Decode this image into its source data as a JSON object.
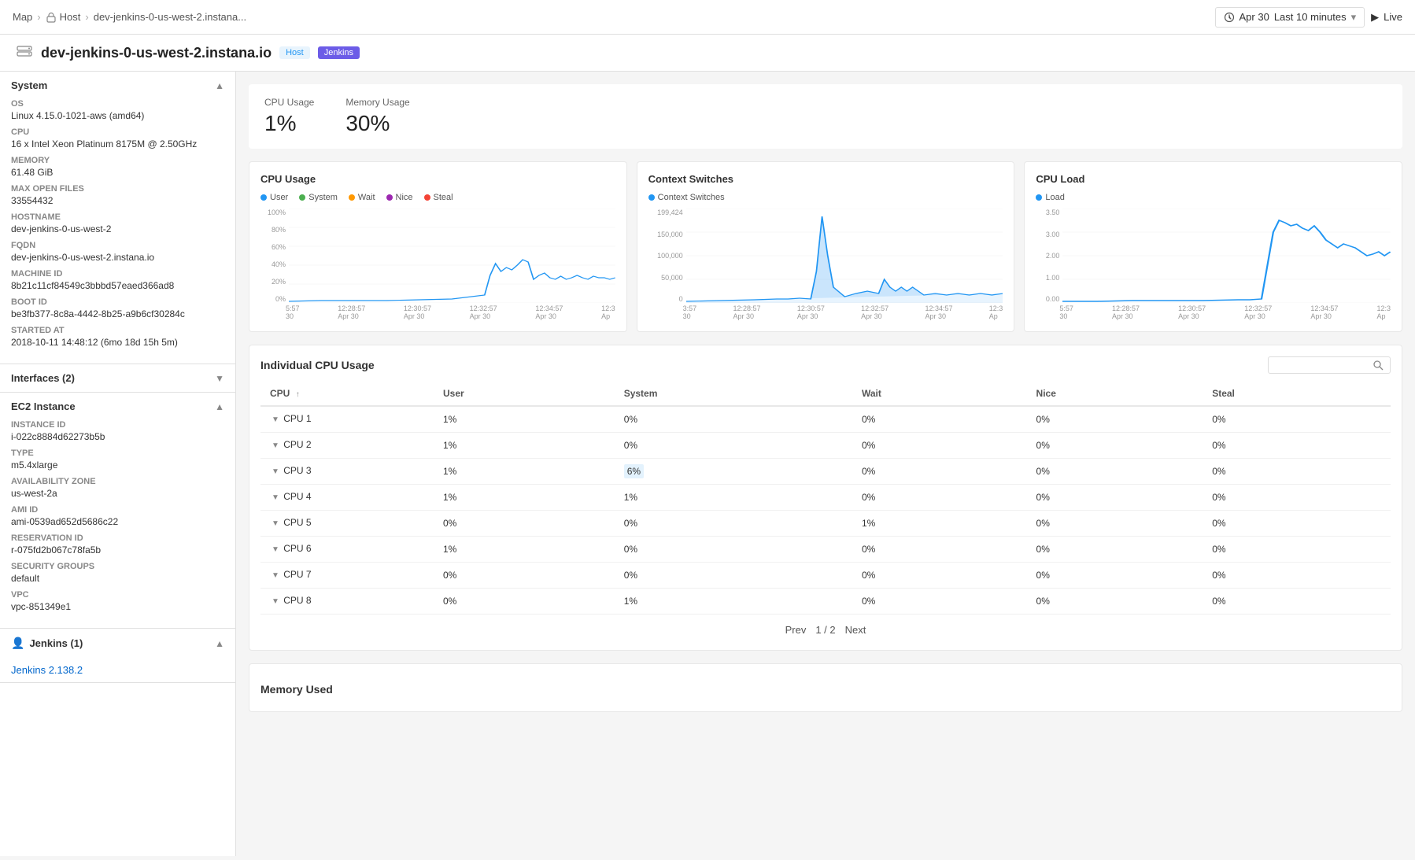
{
  "topNav": {
    "breadcrumb": [
      "Map",
      "Host",
      "dev-jenkins-0-us-west-2.instana..."
    ],
    "date": "Apr 30",
    "timeRange": "Last 10 minutes",
    "live": "Live"
  },
  "pageHeader": {
    "title": "dev-jenkins-0-us-west-2.instana.io",
    "tagHost": "Host",
    "tagJenkins": "Jenkins"
  },
  "summary": {
    "cpuLabel": "CPU Usage",
    "cpuValue": "1%",
    "memLabel": "Memory Usage",
    "memValue": "30%"
  },
  "charts": {
    "cpuUsage": {
      "title": "CPU Usage",
      "legend": [
        "User",
        "System",
        "Wait",
        "Nice",
        "Steal"
      ],
      "legendColors": [
        "#2196F3",
        "#4CAF50",
        "#FF9800",
        "#9C27B0",
        "#F44336"
      ],
      "yLabels": [
        "100%",
        "80%",
        "60%",
        "40%",
        "20%",
        "0%"
      ],
      "xLabels": [
        "5:57\n30",
        "12:28:57\nApr 30",
        "12:30:57\nApr 30",
        "12:32:57\nApr 30",
        "12:34:57\nApr 30",
        "12:3\nAp"
      ]
    },
    "contextSwitches": {
      "title": "Context Switches",
      "legend": [
        "Context Switches"
      ],
      "legendColors": [
        "#2196F3"
      ],
      "yLabels": [
        "199,424",
        "150,000",
        "100,000",
        "50,000",
        "0"
      ],
      "xLabels": [
        "3:57\n30",
        "12:28:57\nApr 30",
        "12:30:57\nApr 30",
        "12:32:57\nApr 30",
        "12:34:57\nApr 30",
        "12:3\nAp"
      ]
    },
    "cpuLoad": {
      "title": "CPU Load",
      "legend": [
        "Load"
      ],
      "legendColors": [
        "#2196F3"
      ],
      "yLabels": [
        "3.50",
        "3.00",
        "2.00",
        "1.00",
        "0.00"
      ],
      "xLabels": [
        "5:57\n30",
        "12:28:57\nApr 30",
        "12:30:57\nApr 30",
        "12:32:57\nApr 30",
        "12:34:57\nApr 30",
        "12:3\nAp"
      ]
    }
  },
  "cpuTable": {
    "title": "Individual CPU Usage",
    "searchPlaceholder": "",
    "columns": [
      "CPU",
      "User",
      "System",
      "Wait",
      "Nice",
      "Steal"
    ],
    "rows": [
      {
        "name": "CPU 1",
        "user": "1%",
        "system": "0%",
        "wait": "0%",
        "nice": "0%",
        "steal": "0%"
      },
      {
        "name": "CPU 2",
        "user": "1%",
        "system": "0%",
        "wait": "0%",
        "nice": "0%",
        "steal": "0%"
      },
      {
        "name": "CPU 3",
        "user": "1%",
        "system": "6%",
        "wait": "0%",
        "nice": "0%",
        "steal": "0%"
      },
      {
        "name": "CPU 4",
        "user": "1%",
        "system": "1%",
        "wait": "0%",
        "nice": "0%",
        "steal": "0%"
      },
      {
        "name": "CPU 5",
        "user": "0%",
        "system": "0%",
        "wait": "1%",
        "nice": "0%",
        "steal": "0%"
      },
      {
        "name": "CPU 6",
        "user": "1%",
        "system": "0%",
        "wait": "0%",
        "nice": "0%",
        "steal": "0%"
      },
      {
        "name": "CPU 7",
        "user": "0%",
        "system": "0%",
        "wait": "0%",
        "nice": "0%",
        "steal": "0%"
      },
      {
        "name": "CPU 8",
        "user": "0%",
        "system": "1%",
        "wait": "0%",
        "nice": "0%",
        "steal": "0%"
      }
    ],
    "pagination": {
      "prev": "Prev",
      "page": "1 / 2",
      "next": "Next"
    }
  },
  "sidebar": {
    "sections": {
      "system": {
        "label": "System",
        "fields": [
          {
            "label": "OS",
            "value": "Linux 4.15.0-1021-aws (amd64)"
          },
          {
            "label": "CPU",
            "value": "16 x Intel Xeon Platinum 8175M @ 2.50GHz"
          },
          {
            "label": "Memory",
            "value": "61.48 GiB"
          },
          {
            "label": "Max Open Files",
            "value": "33554432"
          },
          {
            "label": "Hostname",
            "value": "dev-jenkins-0-us-west-2"
          },
          {
            "label": "FQDN",
            "value": "dev-jenkins-0-us-west-2.instana.io"
          },
          {
            "label": "Machine ID",
            "value": "8b21c11cf84549c3bbbd57eaed366ad8"
          },
          {
            "label": "Boot ID",
            "value": "be3fb377-8c8a-4442-8b25-a9b6cf30284c"
          },
          {
            "label": "Started At",
            "value": "2018-10-11 14:48:12 (6mo 18d 15h 5m)"
          }
        ]
      },
      "interfaces": {
        "label": "Interfaces (2)"
      },
      "ec2": {
        "label": "EC2 Instance",
        "fields": [
          {
            "label": "Instance ID",
            "value": "i-022c8884d62273b5b"
          },
          {
            "label": "Type",
            "value": "m5.4xlarge"
          },
          {
            "label": "Availability Zone",
            "value": "us-west-2a"
          },
          {
            "label": "AMI ID",
            "value": "ami-0539ad652d5686c22"
          },
          {
            "label": "Reservation ID",
            "value": "r-075fd2b067c78fa5b"
          },
          {
            "label": "Security Groups",
            "value": "default"
          },
          {
            "label": "VPC",
            "value": "vpc-851349e1"
          }
        ]
      },
      "jenkins": {
        "label": "Jenkins (1)",
        "link": "Jenkins 2.138.2"
      }
    }
  },
  "memorySection": {
    "title": "Memory Used"
  }
}
